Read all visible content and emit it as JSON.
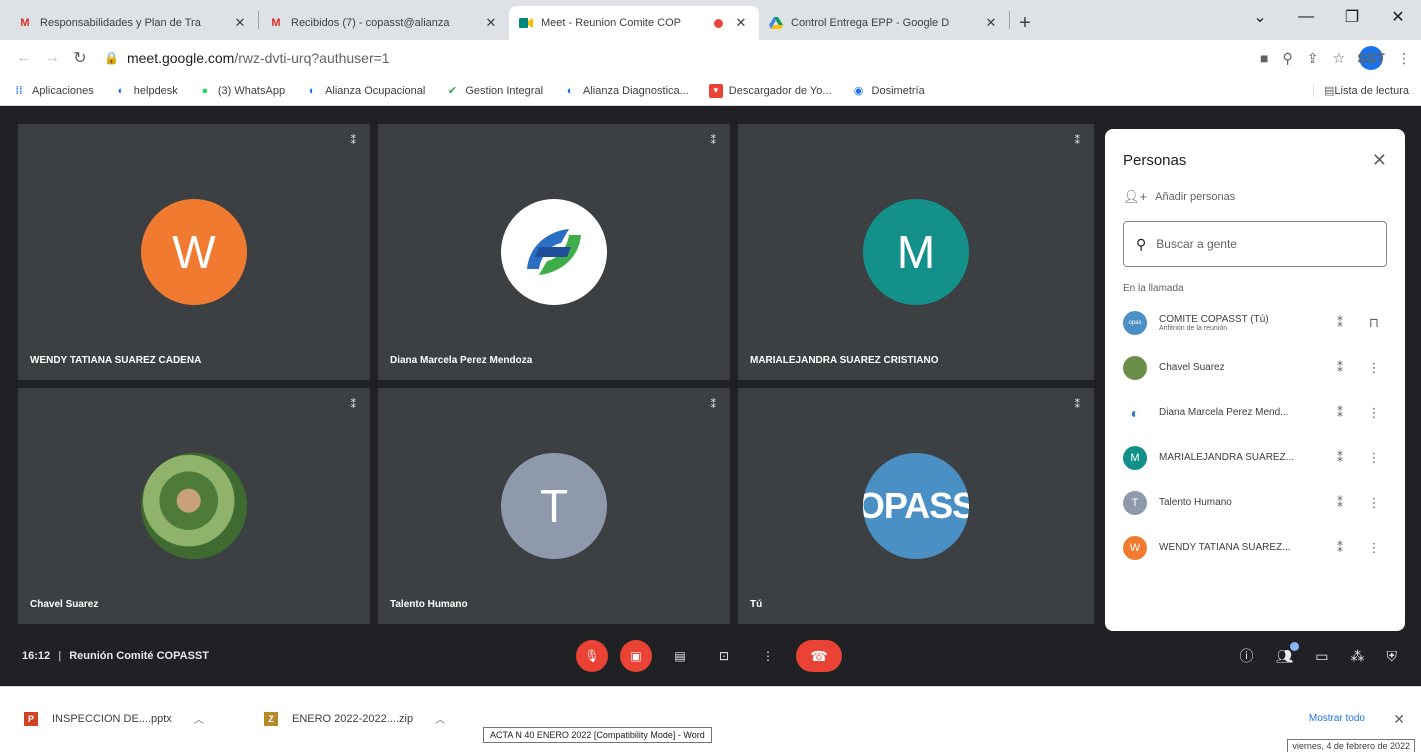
{
  "browser": {
    "tabs": [
      {
        "title": "Responsabilidades y Plan de Tra",
        "icon": "gmail-icon"
      },
      {
        "title": "Recibidos (7) - copasst@alianza",
        "icon": "gmail-icon"
      },
      {
        "title": "Meet - Reunion Comite COP",
        "icon": "meet-icon"
      },
      {
        "title": "Control Entrega EPP - Google D",
        "icon": "drive-icon"
      }
    ],
    "url_host": "meet.google.com",
    "url_path": "/rwz-dvti-urq?authuser=1",
    "profile_initials": "SST",
    "bookmarks": [
      {
        "label": "Aplicaciones"
      },
      {
        "label": "helpdesk"
      },
      {
        "label": "(3) WhatsApp"
      },
      {
        "label": "Alianza Ocupacional"
      },
      {
        "label": "Gestion Integral"
      },
      {
        "label": "Alianza Diagnostica..."
      },
      {
        "label": "Descargador de Yo..."
      },
      {
        "label": "Dosimetría"
      }
    ],
    "reading_list": "Lista de lectura"
  },
  "meet": {
    "tiles": [
      {
        "name": "WENDY TATIANA SUAREZ CADENA",
        "initial": "W",
        "color": "#f07a30"
      },
      {
        "name": "Diana Marcela Perez Mendoza",
        "initial": ""
      },
      {
        "name": "MARIALEJANDRA SUAREZ CRISTIANO",
        "initial": "M",
        "color": "#14908a"
      },
      {
        "name": "Chavel Suarez",
        "initial": ""
      },
      {
        "name": "Talento Humano",
        "initial": "T",
        "color": "#8e9aab"
      },
      {
        "name": "Tú",
        "initial": "OPASS",
        "color": "#4a90c4"
      }
    ],
    "time": "16:12",
    "meeting_name": "Reunión Comité COPASST"
  },
  "people_panel": {
    "title": "Personas",
    "add_people": "Añadir personas",
    "search_placeholder": "Buscar a gente",
    "in_call_label": "En la llamada",
    "people": [
      {
        "name": "COMITE COPASST (Tú)",
        "sub": "Anfitrión de la reunión",
        "initial": "",
        "color": "#4a90c4"
      },
      {
        "name": "Chavel Suarez",
        "sub": "",
        "initial": "",
        "color": "#6b8f4a"
      },
      {
        "name": "Diana Marcela Perez Mend...",
        "sub": "",
        "initial": "",
        "color": "#ffffff"
      },
      {
        "name": "MARIALEJANDRA SUAREZ...",
        "sub": "",
        "initial": "M",
        "color": "#14908a"
      },
      {
        "name": "Talento Humano",
        "sub": "",
        "initial": "T",
        "color": "#8e9aab"
      },
      {
        "name": "WENDY TATIANA SUAREZ...",
        "sub": "",
        "initial": "W",
        "color": "#f07a30"
      }
    ]
  },
  "downloads": {
    "items": [
      {
        "name": "INSPECCION DE....pptx",
        "icon": "powerpoint-icon"
      },
      {
        "name": "ENERO 2022-2022....zip",
        "icon": "zip-icon"
      }
    ],
    "tooltip": "ACTA N 40 ENERO 2022 [Compatibility Mode] - Word",
    "show_all": "Mostrar todo",
    "date": "viernes, 4 de febrero de 2022"
  }
}
